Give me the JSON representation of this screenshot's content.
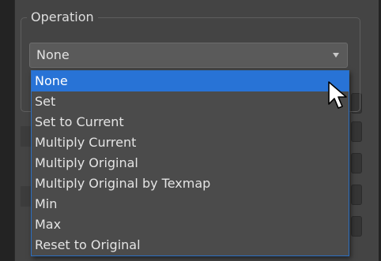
{
  "group": {
    "title": "Operation"
  },
  "combo": {
    "value": "None"
  },
  "dropdown": {
    "items": [
      {
        "label": "None",
        "selected": true
      },
      {
        "label": "Set",
        "selected": false
      },
      {
        "label": "Set to Current",
        "selected": false
      },
      {
        "label": "Multiply Current",
        "selected": false
      },
      {
        "label": "Multiply Original",
        "selected": false
      },
      {
        "label": "Multiply Original by Texmap",
        "selected": false
      },
      {
        "label": "Min",
        "selected": false
      },
      {
        "label": "Max",
        "selected": false
      },
      {
        "label": "Reset to Original",
        "selected": false
      }
    ]
  },
  "colors": {
    "selection": "#2873d6",
    "dropdown_border": "#2a6fc3",
    "panel": "#444444",
    "text": "#e4e4e4"
  },
  "icons": {
    "cursor": "arrow-cursor-icon",
    "combo_arrow": "triangle-down-icon"
  }
}
